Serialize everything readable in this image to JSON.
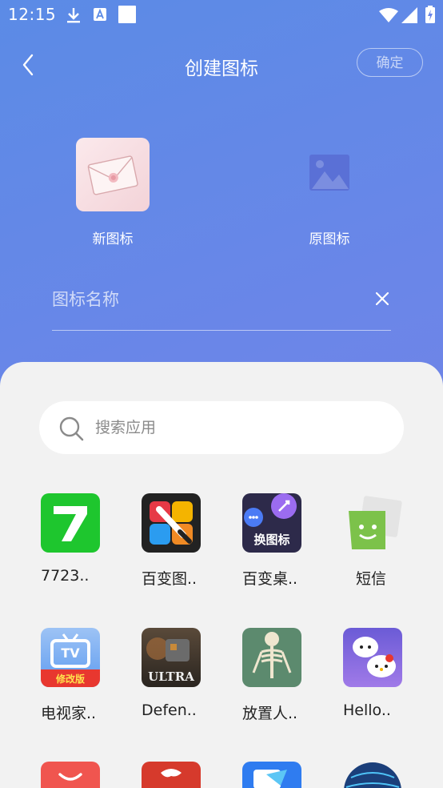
{
  "status_bar": {
    "time": "12:15"
  },
  "header": {
    "title": "创建图标",
    "confirm_label": "确定"
  },
  "preview": {
    "new_label": "新图标",
    "original_label": "原图标"
  },
  "name_field": {
    "placeholder": "图标名称",
    "value": ""
  },
  "search": {
    "placeholder": "搜索应用",
    "value": ""
  },
  "apps": [
    {
      "label": "7723..",
      "icon": "7723-app-icon"
    },
    {
      "label": "百变图..",
      "icon": "brush-app-icon",
      "overlay_text": ""
    },
    {
      "label": "百变桌..",
      "icon": "change-icon-app-icon",
      "overlay_text": "换图标"
    },
    {
      "label": "短信",
      "icon": "sms-app-icon"
    },
    {
      "label": "电视家..",
      "icon": "tv-app-icon",
      "overlay_text": "TV",
      "badge_text": "修改版"
    },
    {
      "label": "Defen..",
      "icon": "defense-game-icon",
      "overlay_text": "ULTRA"
    },
    {
      "label": "放置人..",
      "icon": "skeleton-app-icon"
    },
    {
      "label": "Hello..",
      "icon": "hello-kitty-app-icon"
    },
    {
      "label": "",
      "icon": "red-smile-app-icon"
    },
    {
      "label": "",
      "icon": "red-dragon-app-icon"
    },
    {
      "label": "",
      "icon": "blue-app-icon"
    },
    {
      "label": "",
      "icon": "globe-app-icon"
    }
  ],
  "colors": {
    "gradient_start": "#5b8be6",
    "gradient_end": "#7b80e4",
    "sheet_bg": "#f2f2f2"
  }
}
